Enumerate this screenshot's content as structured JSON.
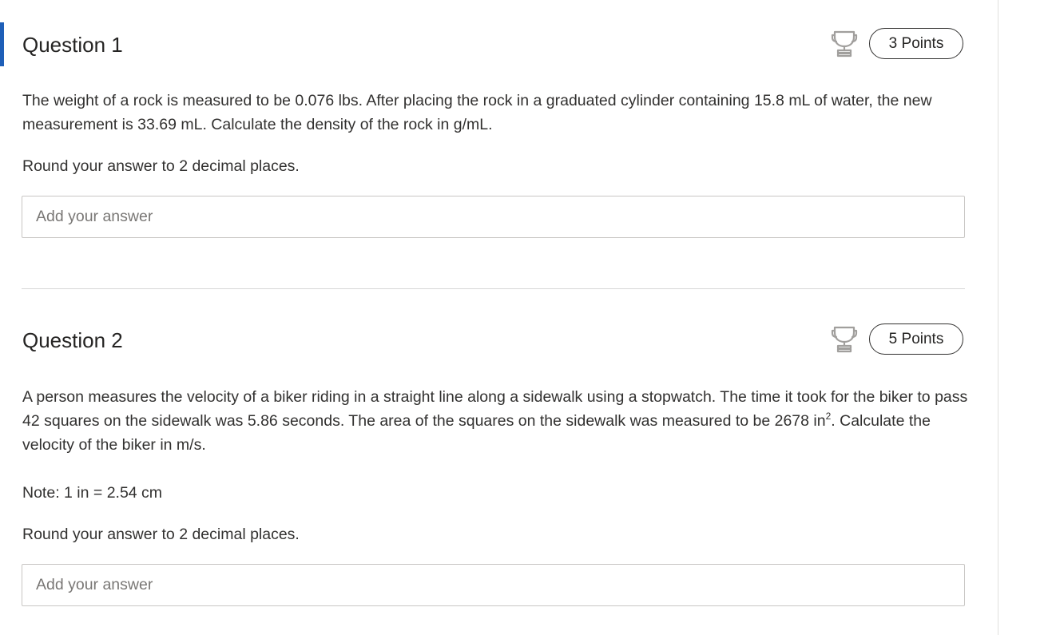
{
  "questions": [
    {
      "title": "Question 1",
      "points": "3 Points",
      "text1": "The weight of a rock is measured to be 0.076 lbs. After placing the rock in a graduated cylinder containing 15.8 mL of water, the new measurement is 33.69 mL. Calculate the density of the rock in g/mL.",
      "text2": "Round your answer to 2 decimal places.",
      "answer_placeholder": "Add your answer",
      "answer_value": ""
    },
    {
      "title": "Question 2",
      "points": "5 Points",
      "text1_main": "A person measures the velocity of a biker riding in a straight line along a sidewalk using a stopwatch. The time it took for the biker to pass 42 squares on the sidewalk was 5.86 seconds. The area of the squares on the sidewalk was measured to be 2678 in",
      "text1_sup": "2",
      "text1_end": ". Calculate the velocity of the biker in m/s.",
      "note": "Note: 1 in = 2.54 cm",
      "text2": "Round your answer to 2 decimal places.",
      "answer_placeholder": "Add your answer",
      "answer_value": ""
    }
  ],
  "icons": {
    "trophy": "trophy-icon"
  },
  "colors": {
    "accent": "#1e5fb8",
    "border": "#c8c6c4"
  }
}
